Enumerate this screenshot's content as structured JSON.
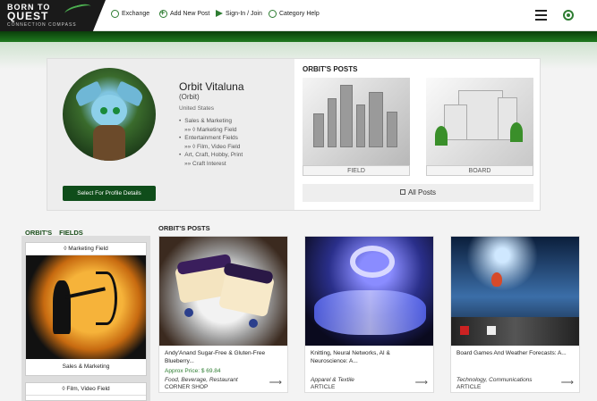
{
  "header": {
    "logo_line1": "BORN TO",
    "logo_line2": "QUEST",
    "logo_line3": "CONNECTION COMPASS",
    "nav": [
      {
        "label": "Exchange"
      },
      {
        "label": "Add New Post"
      },
      {
        "label": "Sign-In / Join"
      },
      {
        "label": "Category Help"
      }
    ]
  },
  "profile": {
    "name": "Orbit Vitaluna",
    "handle": "(Orbit)",
    "country": "United States",
    "interests": [
      {
        "category": "Sales & Marketing",
        "field": "»» ◊ Marketing Field"
      },
      {
        "category": "Entertainment Fields",
        "field": "»» ◊ Film, Video Field"
      },
      {
        "category": "Art, Craft, Hobby, Print",
        "field": "»» Craft Interest"
      }
    ],
    "select_button": "Select For Profile Details",
    "posts_title": "ORBIT'S POSTS",
    "thumbs": [
      {
        "label": "FIELD"
      },
      {
        "label": "BOARD"
      }
    ],
    "all_posts": "All Posts"
  },
  "fields": {
    "title_a": "ORBIT'S",
    "title_b": "FIELDS",
    "cards": [
      {
        "header": "◊ Marketing Field",
        "footer": "Sales & Marketing"
      },
      {
        "header": "◊ Film, Video Field",
        "footer": ""
      }
    ]
  },
  "posts": {
    "title": "ORBIT'S POSTS",
    "items": [
      {
        "title": "Andy'Anand Sugar-Free & Gluten-Free Blueberry...",
        "price": "Approx Price: $ 69.84",
        "category": "Food, Beverage, Restaurant",
        "type": "CORNER SHOP"
      },
      {
        "title": "Knitting, Neural Networks, AI & Neuroscience: A...",
        "price": "",
        "category": "Apparel & Textile",
        "type": "ARTICLE"
      },
      {
        "title": "Board Games And Weather Forecasts: A...",
        "price": "",
        "category": "Technology, Communications",
        "type": "ARTICLE"
      }
    ]
  },
  "colors": {
    "accent": "#2e7d32",
    "dark_green": "#0f4d1a"
  },
  "icons": [
    "compass-icon",
    "plus-circle-icon",
    "sign-in-arrow-icon",
    "category-icon",
    "menu-icon",
    "target-icon",
    "arrow-right-icon"
  ]
}
